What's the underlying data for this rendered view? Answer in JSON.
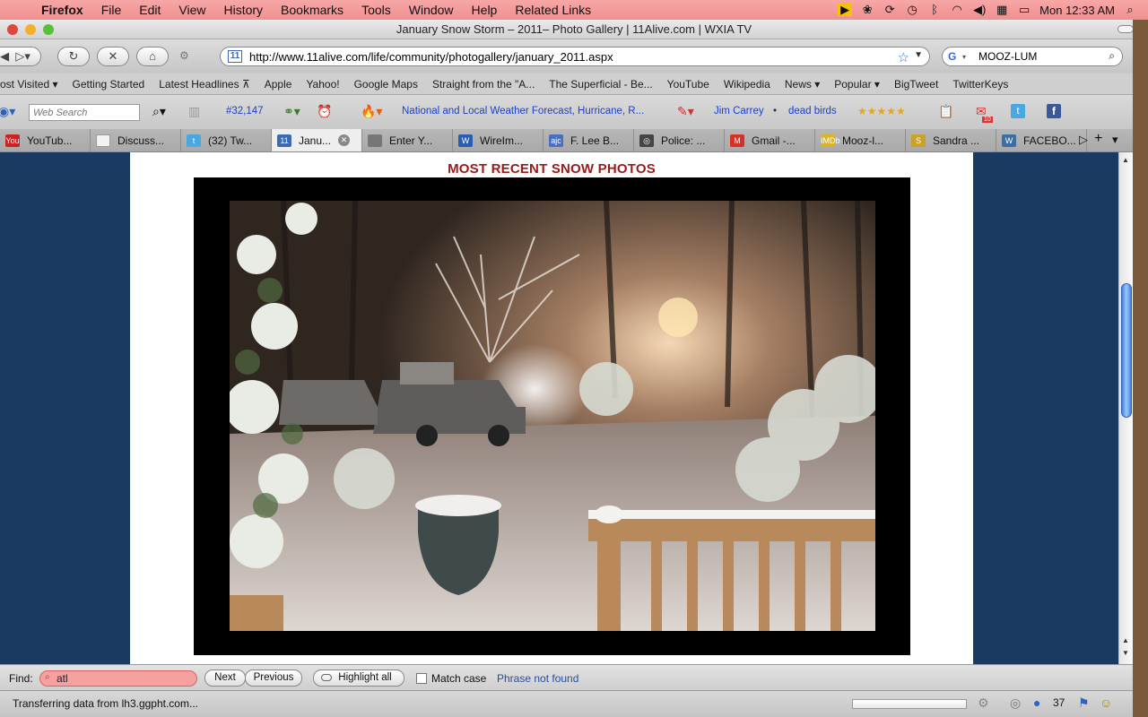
{
  "menubar": {
    "items": [
      "Firefox",
      "File",
      "Edit",
      "View",
      "History",
      "Bookmarks",
      "Tools",
      "Window",
      "Help",
      "Related Links"
    ],
    "clock": "Mon 12:33 AM"
  },
  "window": {
    "title": "January Snow Storm – 2011– Photo Gallery | 11Alive.com | WXIA TV"
  },
  "navbar": {
    "url": "http://www.11alive.com/life/community/photogallery/january_2011.aspx",
    "search_value": "MOOZ-LUM",
    "site_icon_text": "11"
  },
  "bookmarks": [
    "ost Visited ▾",
    "Getting Started",
    "Latest Headlines ⊼",
    "Apple",
    "Yahoo!",
    "Google Maps",
    "Straight from the \"A...",
    "The Superficial - Be...",
    "YouTube",
    "Wikipedia",
    "News ▾",
    "Popular ▾",
    "BigTweet",
    "TwitterKeys"
  ],
  "addonbar": {
    "search_placeholder": "Web Search",
    "count": "#32,147",
    "weather_link": "National and Local Weather Forecast, Hurricane, R...",
    "link_jim": "Jim Carrey",
    "link_dead": "dead birds",
    "gmail_badge": "10"
  },
  "tabs": [
    {
      "label": "YouTub...",
      "icon": "youtube-icon",
      "icon_text": "You",
      "color": "#cc2222"
    },
    {
      "label": "Discuss...",
      "icon": "page-icon",
      "icon_text": "",
      "color": "#f2f2f2"
    },
    {
      "label": "(32) Tw...",
      "icon": "twitter-icon",
      "icon_text": "t",
      "color": "#4aa8e0"
    },
    {
      "label": "Janu...",
      "icon": "11alive-icon",
      "icon_text": "11",
      "color": "#3b6bb3",
      "active": true
    },
    {
      "label": "Enter Y...",
      "icon": "person-icon",
      "icon_text": "",
      "color": "#777777"
    },
    {
      "label": "WireIm...",
      "icon": "wordpress-w-icon",
      "icon_text": "W",
      "color": "#2a5db0"
    },
    {
      "label": "F. Lee B...",
      "icon": "ajc-icon",
      "icon_text": "ajc",
      "color": "#4b6fc0"
    },
    {
      "label": "Police: ...",
      "icon": "globe-icon",
      "icon_text": "◎",
      "color": "#444444"
    },
    {
      "label": "Gmail -...",
      "icon": "gmail-icon",
      "icon_text": "M",
      "color": "#d93025"
    },
    {
      "label": "Mooz-l...",
      "icon": "imdb-icon",
      "icon_text": "IMDb",
      "color": "#d8b429"
    },
    {
      "label": "Sandra ...",
      "icon": "dollar-icon",
      "icon_text": "S",
      "color": "#c9a227"
    },
    {
      "label": "FACEBO...",
      "icon": "wordpress-icon",
      "icon_text": "W",
      "color": "#3a6ea5"
    }
  ],
  "page": {
    "heading": "MOST RECENT SNOW PHOTOS"
  },
  "findbar": {
    "label": "Find:",
    "query": "atl",
    "next": "Next",
    "previous": "Previous",
    "highlight": "Highlight all",
    "match_case": "Match case",
    "status": "Phrase not found"
  },
  "statusbar": {
    "text": "Transferring data from lh3.ggpht.com...",
    "count": "37"
  },
  "colors": {
    "page_bg": "#1b3a62",
    "heading": "#9a1a1a",
    "link": "#1a3fd0",
    "find_error": "#f7a0a0"
  }
}
